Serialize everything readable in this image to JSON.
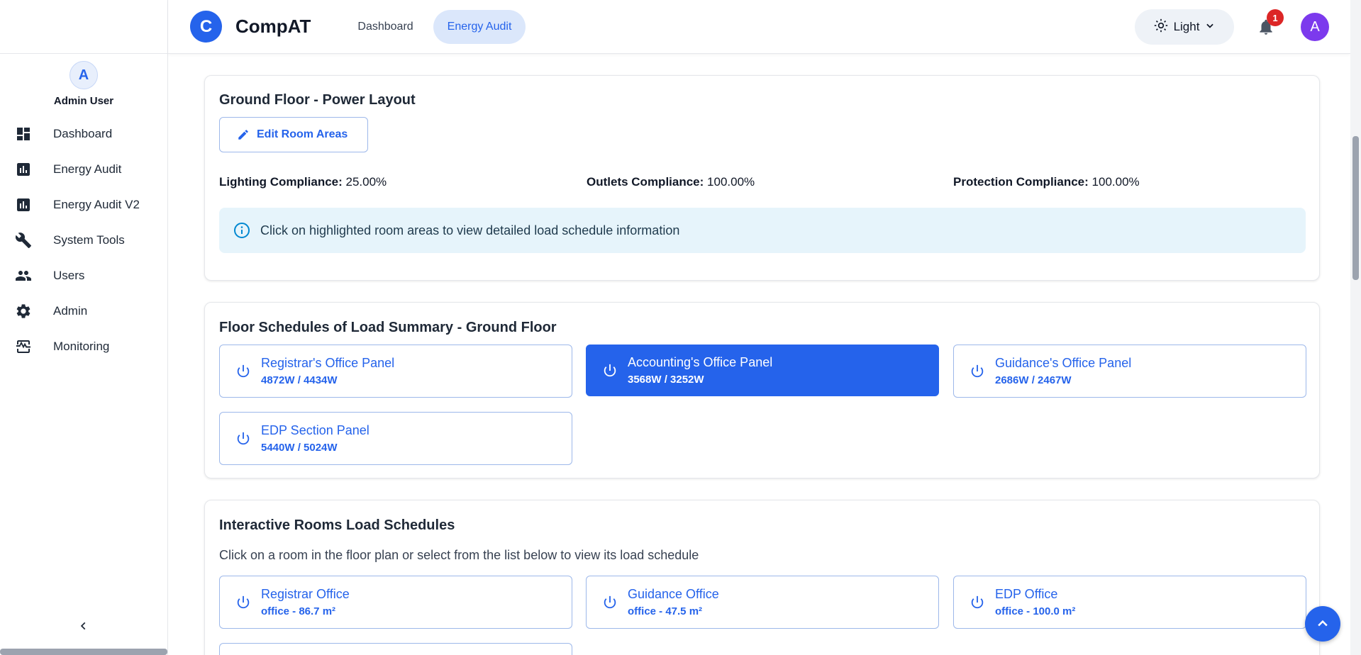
{
  "app": {
    "logo_letter": "C",
    "brand": "CompAT",
    "accent": "#2563eb"
  },
  "header": {
    "tabs": [
      {
        "label": "Dashboard",
        "active": false
      },
      {
        "label": "Energy Audit",
        "active": true
      }
    ],
    "theme_label": "Light",
    "notification_count": "1",
    "avatar_letter": "A"
  },
  "sidebar": {
    "user": {
      "avatar_letter": "A",
      "name": "Admin User"
    },
    "items": [
      {
        "label": "Dashboard",
        "icon": "dashboard-icon"
      },
      {
        "label": "Energy Audit",
        "icon": "bar-chart-icon"
      },
      {
        "label": "Energy Audit V2",
        "icon": "bar-chart-icon"
      },
      {
        "label": "System Tools",
        "icon": "wrench-icon"
      },
      {
        "label": "Users",
        "icon": "users-icon"
      },
      {
        "label": "Admin",
        "icon": "gear-icon"
      },
      {
        "label": "Monitoring",
        "icon": "monitoring-icon"
      }
    ]
  },
  "power_layout": {
    "title": "Ground Floor - Power Layout",
    "edit_label": "Edit Room Areas",
    "compliance": [
      {
        "label": "Lighting Compliance:",
        "value": "25.00%"
      },
      {
        "label": "Outlets Compliance:",
        "value": "100.00%"
      },
      {
        "label": "Protection Compliance:",
        "value": "100.00%"
      }
    ],
    "info_text": "Click on highlighted room areas to view detailed load schedule information"
  },
  "floor_schedules": {
    "title": "Floor Schedules of Load Summary - Ground Floor",
    "panels": [
      {
        "name": "Registrar's Office Panel",
        "load": "4872W / 4434W",
        "active": false
      },
      {
        "name": "Accounting's Office Panel",
        "load": "3568W / 3252W",
        "active": true
      },
      {
        "name": "Guidance's Office Panel",
        "load": "2686W / 2467W",
        "active": false
      },
      {
        "name": "EDP Section Panel",
        "load": "5440W / 5024W",
        "active": false
      }
    ]
  },
  "rooms": {
    "title": "Interactive Rooms Load Schedules",
    "subtitle": "Click on a room in the floor plan or select from the list below to view its load schedule",
    "items": [
      {
        "name": "Registrar Office",
        "detail": "office - 86.7 m²"
      },
      {
        "name": "Guidance Office",
        "detail": "office - 47.5 m²"
      },
      {
        "name": "EDP Office",
        "detail": "office - 100.0 m²"
      }
    ]
  }
}
